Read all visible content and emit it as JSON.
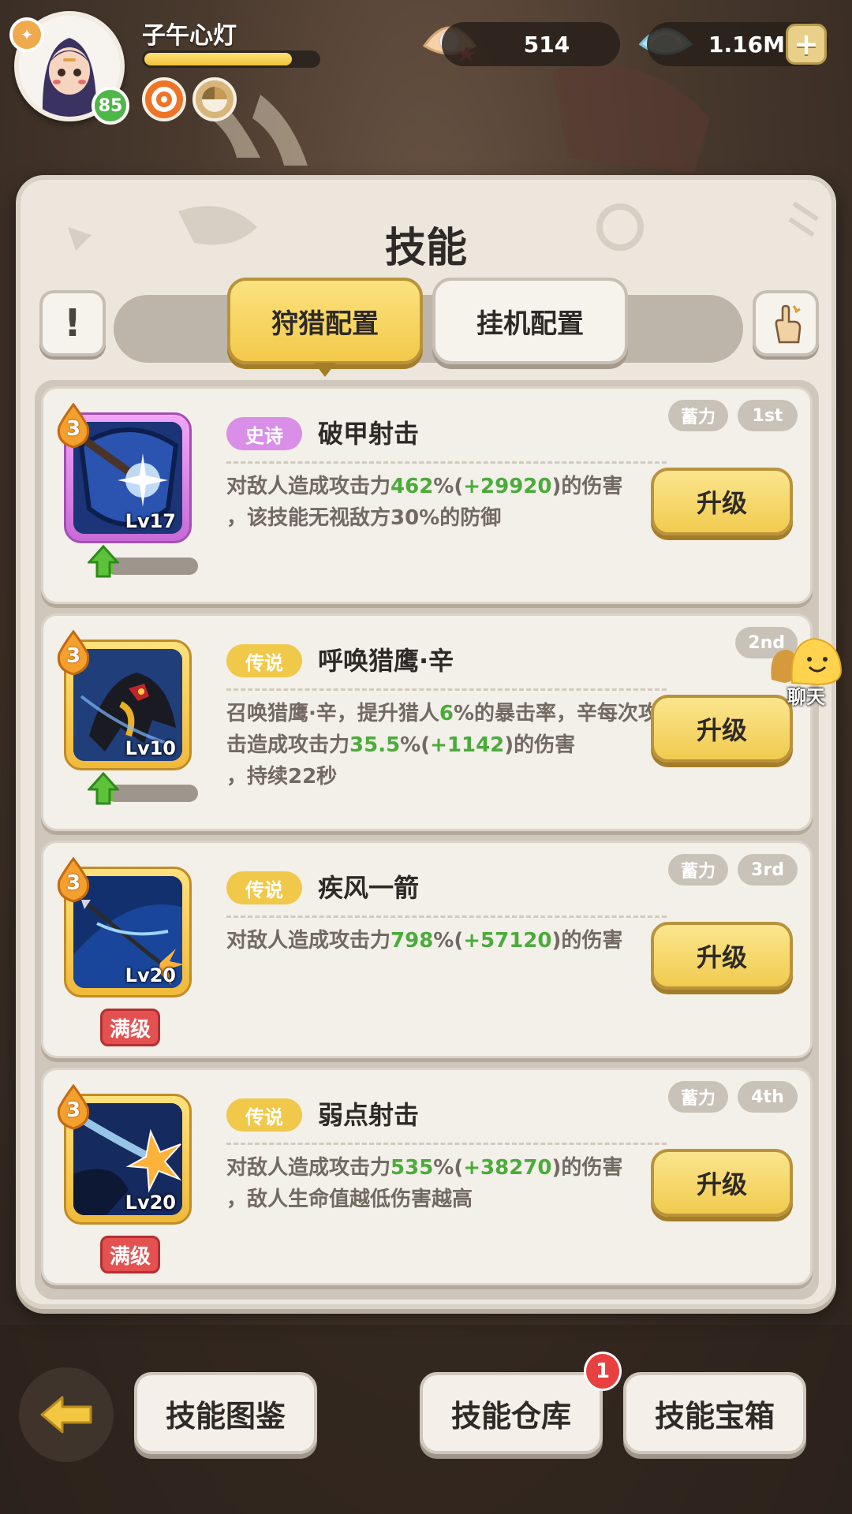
{
  "player": {
    "name": "子午心灯",
    "level": "85",
    "exp_fraction": 0.85
  },
  "currency": {
    "pearls": "514",
    "gems": "1.16M"
  },
  "panel": {
    "title": "技能",
    "tabs": [
      {
        "label": "狩猎配置",
        "active": true
      },
      {
        "label": "挂机配置",
        "active": false
      }
    ]
  },
  "skills": [
    {
      "rarity": "史诗",
      "name": "破甲射击",
      "level": "Lv17",
      "star": "3",
      "tags": [
        "蓄力",
        "1st"
      ],
      "desc_parts": [
        "对敌人造成攻击力",
        "462",
        "%(",
        "+29920",
        ")的伤害",
        "，该技能无视敌方30%的防御"
      ],
      "upgrade_label": "升级",
      "progress": 0.08,
      "max_label": ""
    },
    {
      "rarity": "传说",
      "name": "呼唤猎鹰·辛",
      "level": "Lv10",
      "star": "3",
      "tags": [
        "2nd"
      ],
      "desc_parts": [
        "召唤猎鹰·辛，提升猎人",
        "6",
        "%的暴击率，辛每次攻击造成攻击力",
        "35.5",
        "%(",
        "+1142",
        ")的伤害",
        "，持续22秒"
      ],
      "upgrade_label": "升级",
      "progress": 0.08,
      "max_label": ""
    },
    {
      "rarity": "传说",
      "name": "疾风一箭",
      "level": "Lv20",
      "star": "3",
      "tags": [
        "蓄力",
        "3rd"
      ],
      "desc_parts": [
        "对敌人造成攻击力",
        "798",
        "%(",
        "+57120",
        ")的伤害"
      ],
      "upgrade_label": "升级",
      "max_label": "满级"
    },
    {
      "rarity": "传说",
      "name": "弱点射击",
      "level": "Lv20",
      "star": "3",
      "tags": [
        "蓄力",
        "4th"
      ],
      "desc_parts": [
        "对敌人造成攻击力",
        "535",
        "%(",
        "+38270",
        ")的伤害",
        "，敌人生命值越低伤害越高"
      ],
      "upgrade_label": "升级",
      "max_label": "满级"
    }
  ],
  "chat_label": "聊天",
  "bottom": {
    "buttons": [
      "技能图鉴",
      "技能仓库",
      "技能宝箱"
    ],
    "warehouse_badge": "1"
  },
  "colors": {
    "accent_yellow": "#f1cb4f",
    "highlight_green": "#4bab3b",
    "epic_purple": "#d98ee8",
    "max_red": "#e45151"
  }
}
